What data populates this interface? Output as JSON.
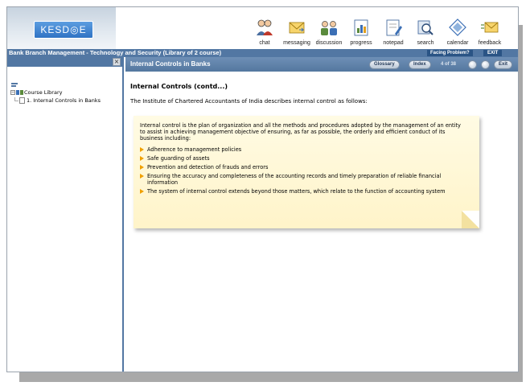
{
  "app": {
    "logo_text": "KESD◎E"
  },
  "toolbar": [
    {
      "label": "chat",
      "icon": "chat-icon"
    },
    {
      "label": "messaging",
      "icon": "envelope-icon"
    },
    {
      "label": "discussion",
      "icon": "discussion-icon"
    },
    {
      "label": "progress",
      "icon": "progress-icon"
    },
    {
      "label": "notepad",
      "icon": "notepad-icon"
    },
    {
      "label": "search",
      "icon": "search-icon"
    },
    {
      "label": "calendar",
      "icon": "calendar-icon"
    },
    {
      "label": "feedback",
      "icon": "feedback-icon"
    }
  ],
  "course": {
    "title": "Bank Branch Management - Technology and Security (Library of 2 course)",
    "facing_problem": "Facing Problem?",
    "exit_label": "EXIT"
  },
  "left_pane": {
    "close_label": "×",
    "tree": [
      {
        "label": "Course Library",
        "icon": "library-icon"
      },
      {
        "label": "1. Internal Controls in Banks",
        "icon": "lesson-icon"
      }
    ]
  },
  "lesson": {
    "title": "Internal Controls in Banks",
    "glossary_label": "Glossary",
    "index_label": "Index",
    "page_indicator": "4 of 38",
    "exit_label": "Exit"
  },
  "content": {
    "heading": "Internal Controls (contd...)",
    "intro": "The Institute of Chartered Accountants of India describes internal control as follows:",
    "note_text": "Internal control is the plan of organization and all the methods and procedures adopted by the management of an entity to assist in achieving management objective of ensuring, as far as possible, the orderly and efficient conduct of its business including:",
    "bullets": [
      "Adherence to management policies",
      "Safe guarding of assets",
      "Prevention and detection of frauds and errors",
      "Ensuring the accuracy and completeness of the accounting records and timely preparation of reliable financial information",
      "The system of internal control extends beyond those matters, which relate to the function of accounting system"
    ]
  },
  "colors": {
    "accent": "#5277a3",
    "note_bg": "#fff4c9",
    "bullet": "#f0a000"
  }
}
